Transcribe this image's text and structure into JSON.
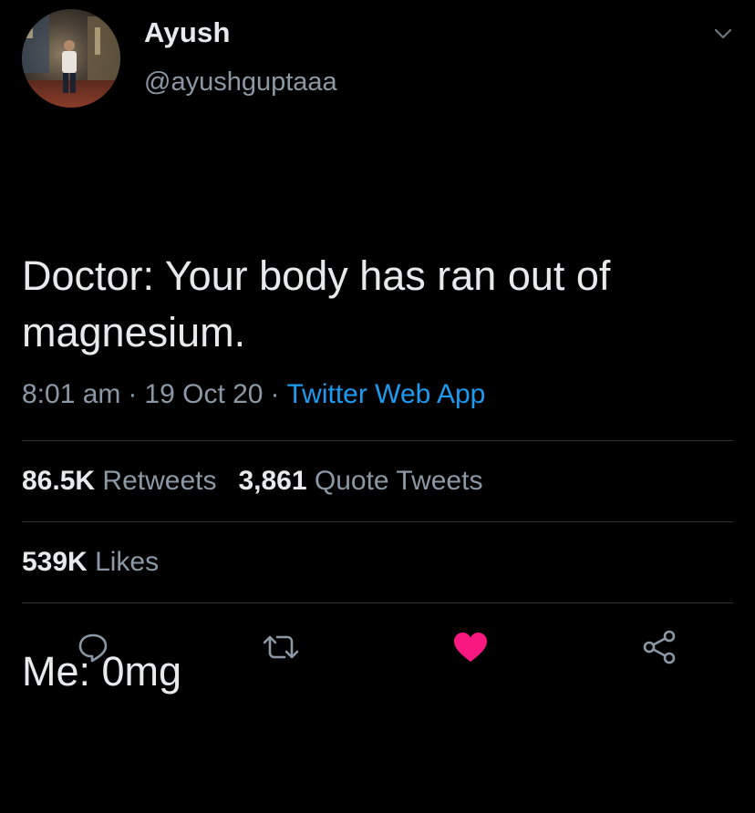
{
  "user": {
    "display_name": "Ayush",
    "handle": "@ayushguptaaa",
    "avatar_icon": "profile-photo"
  },
  "tweet": {
    "line1": "Doctor: Your body has ran out of magnesium.",
    "line2": "Me: 0mg"
  },
  "meta": {
    "time": "8:01 am",
    "separator": "·",
    "date": "19 Oct 20",
    "source": "Twitter Web App"
  },
  "stats": {
    "retweets_count": "86.5K",
    "retweets_label": "Retweets",
    "quotes_count": "3,861",
    "quotes_label": "Quote Tweets",
    "likes_count": "539K",
    "likes_label": "Likes"
  },
  "actions": {
    "reply_icon": "reply-icon",
    "retweet_icon": "retweet-icon",
    "like_icon": "heart-icon",
    "share_icon": "share-icon"
  },
  "colors": {
    "background": "#000000",
    "text": "#e7e9ea",
    "secondary": "#8b98a5",
    "link": "#1d9bf0",
    "like": "#f91880",
    "divider": "#2f3336"
  }
}
